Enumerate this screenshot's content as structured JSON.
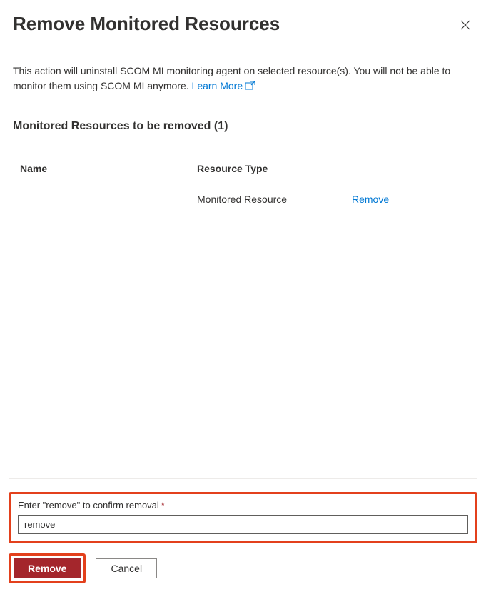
{
  "header": {
    "title": "Remove Monitored Resources"
  },
  "description": {
    "text1": "This action will uninstall SCOM MI monitoring agent on selected resource(s). You will not be able to monitor them using SCOM MI anymore. ",
    "learn_more": "Learn More"
  },
  "section": {
    "title": "Monitored Resources to be removed (1)"
  },
  "table": {
    "headers": {
      "name": "Name",
      "type": "Resource Type"
    },
    "rows": [
      {
        "name": "",
        "type": "Monitored Resource",
        "action": "Remove"
      }
    ]
  },
  "confirm": {
    "label": "Enter \"remove\" to confirm removal",
    "value": "remove"
  },
  "buttons": {
    "remove": "Remove",
    "cancel": "Cancel"
  }
}
